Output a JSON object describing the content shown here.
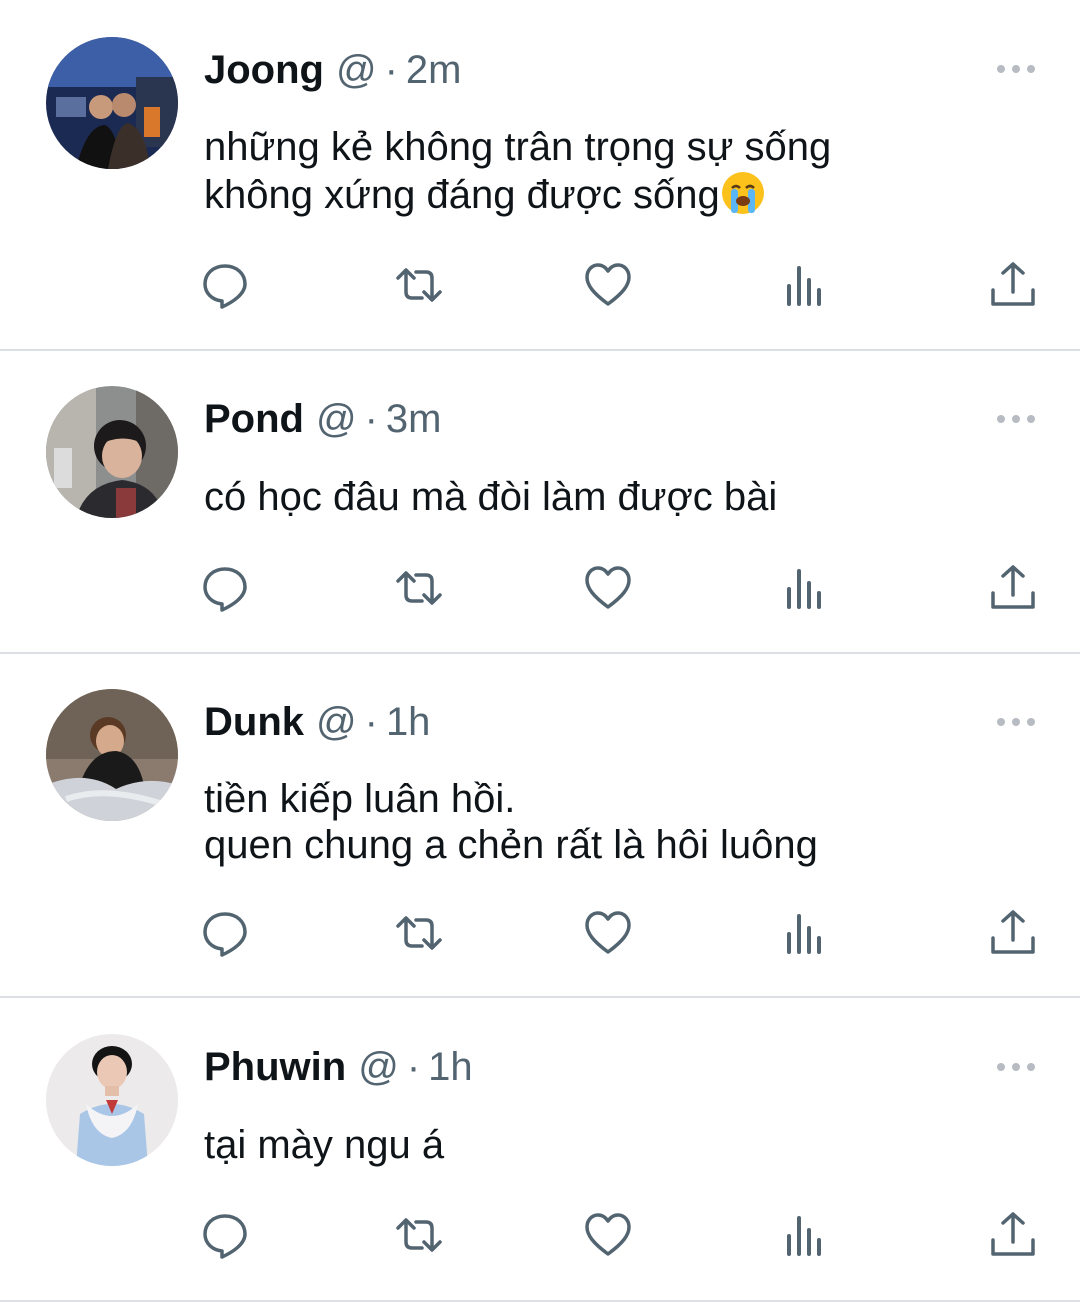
{
  "tweets": [
    {
      "name": "Joong",
      "handle": "@",
      "separator": "·",
      "time": "2m",
      "text": "những kẻ không trân trọng sự sống\nkhông xứng đáng được sống",
      "emoji": "loudly-crying-face-emoji",
      "avatar": "avatar-joong"
    },
    {
      "name": "Pond",
      "handle": "@",
      "separator": "·",
      "time": "3m",
      "text": "có học đâu mà đòi làm được bài",
      "avatar": "avatar-pond"
    },
    {
      "name": "Dunk",
      "handle": "@",
      "separator": "·",
      "time": "1h",
      "text": "tiền kiếp luân hồi.\nquen chung a chẻn rất là hôi luông",
      "avatar": "avatar-dunk"
    },
    {
      "name": "Phuwin",
      "handle": "@",
      "separator": "·",
      "time": "1h",
      "text": "tại mày ngu á",
      "avatar": "avatar-phuwin"
    }
  ],
  "action_icons": [
    "reply-icon",
    "retweet-icon",
    "like-icon",
    "views-icon",
    "share-icon"
  ],
  "colors": {
    "text": "#0f1419",
    "secondary": "#536471",
    "divider": "#dcdfe3",
    "background": "#ffffff"
  }
}
